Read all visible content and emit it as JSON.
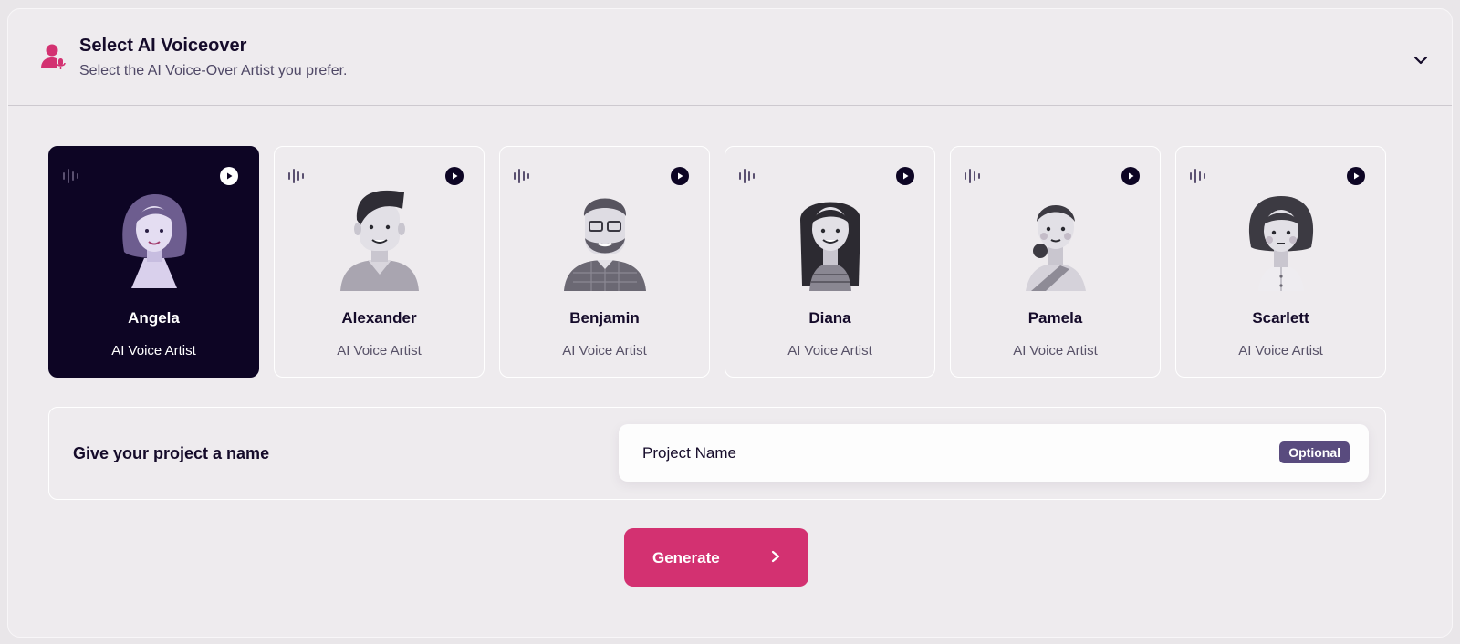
{
  "header": {
    "title": "Select AI Voiceover",
    "subtitle": "Select the AI Voice-Over Artist you prefer.",
    "icon": "user-mic-icon",
    "collapse_icon": "chevron-down-icon"
  },
  "artists": [
    {
      "name": "Angela",
      "role": "AI Voice Artist",
      "selected": true
    },
    {
      "name": "Alexander",
      "role": "AI Voice Artist",
      "selected": false
    },
    {
      "name": "Benjamin",
      "role": "AI Voice Artist",
      "selected": false
    },
    {
      "name": "Diana",
      "role": "AI Voice Artist",
      "selected": false
    },
    {
      "name": "Pamela",
      "role": "AI Voice Artist",
      "selected": false
    },
    {
      "name": "Scarlett",
      "role": "AI Voice Artist",
      "selected": false
    }
  ],
  "project": {
    "label": "Give your project a name",
    "placeholder": "Project Name",
    "value": "",
    "badge": "Optional"
  },
  "actions": {
    "generate_label": "Generate"
  },
  "colors": {
    "accent": "#d33171",
    "selected_card": "#0d0524",
    "badge": "#594b7e",
    "background": "#eeebee"
  }
}
